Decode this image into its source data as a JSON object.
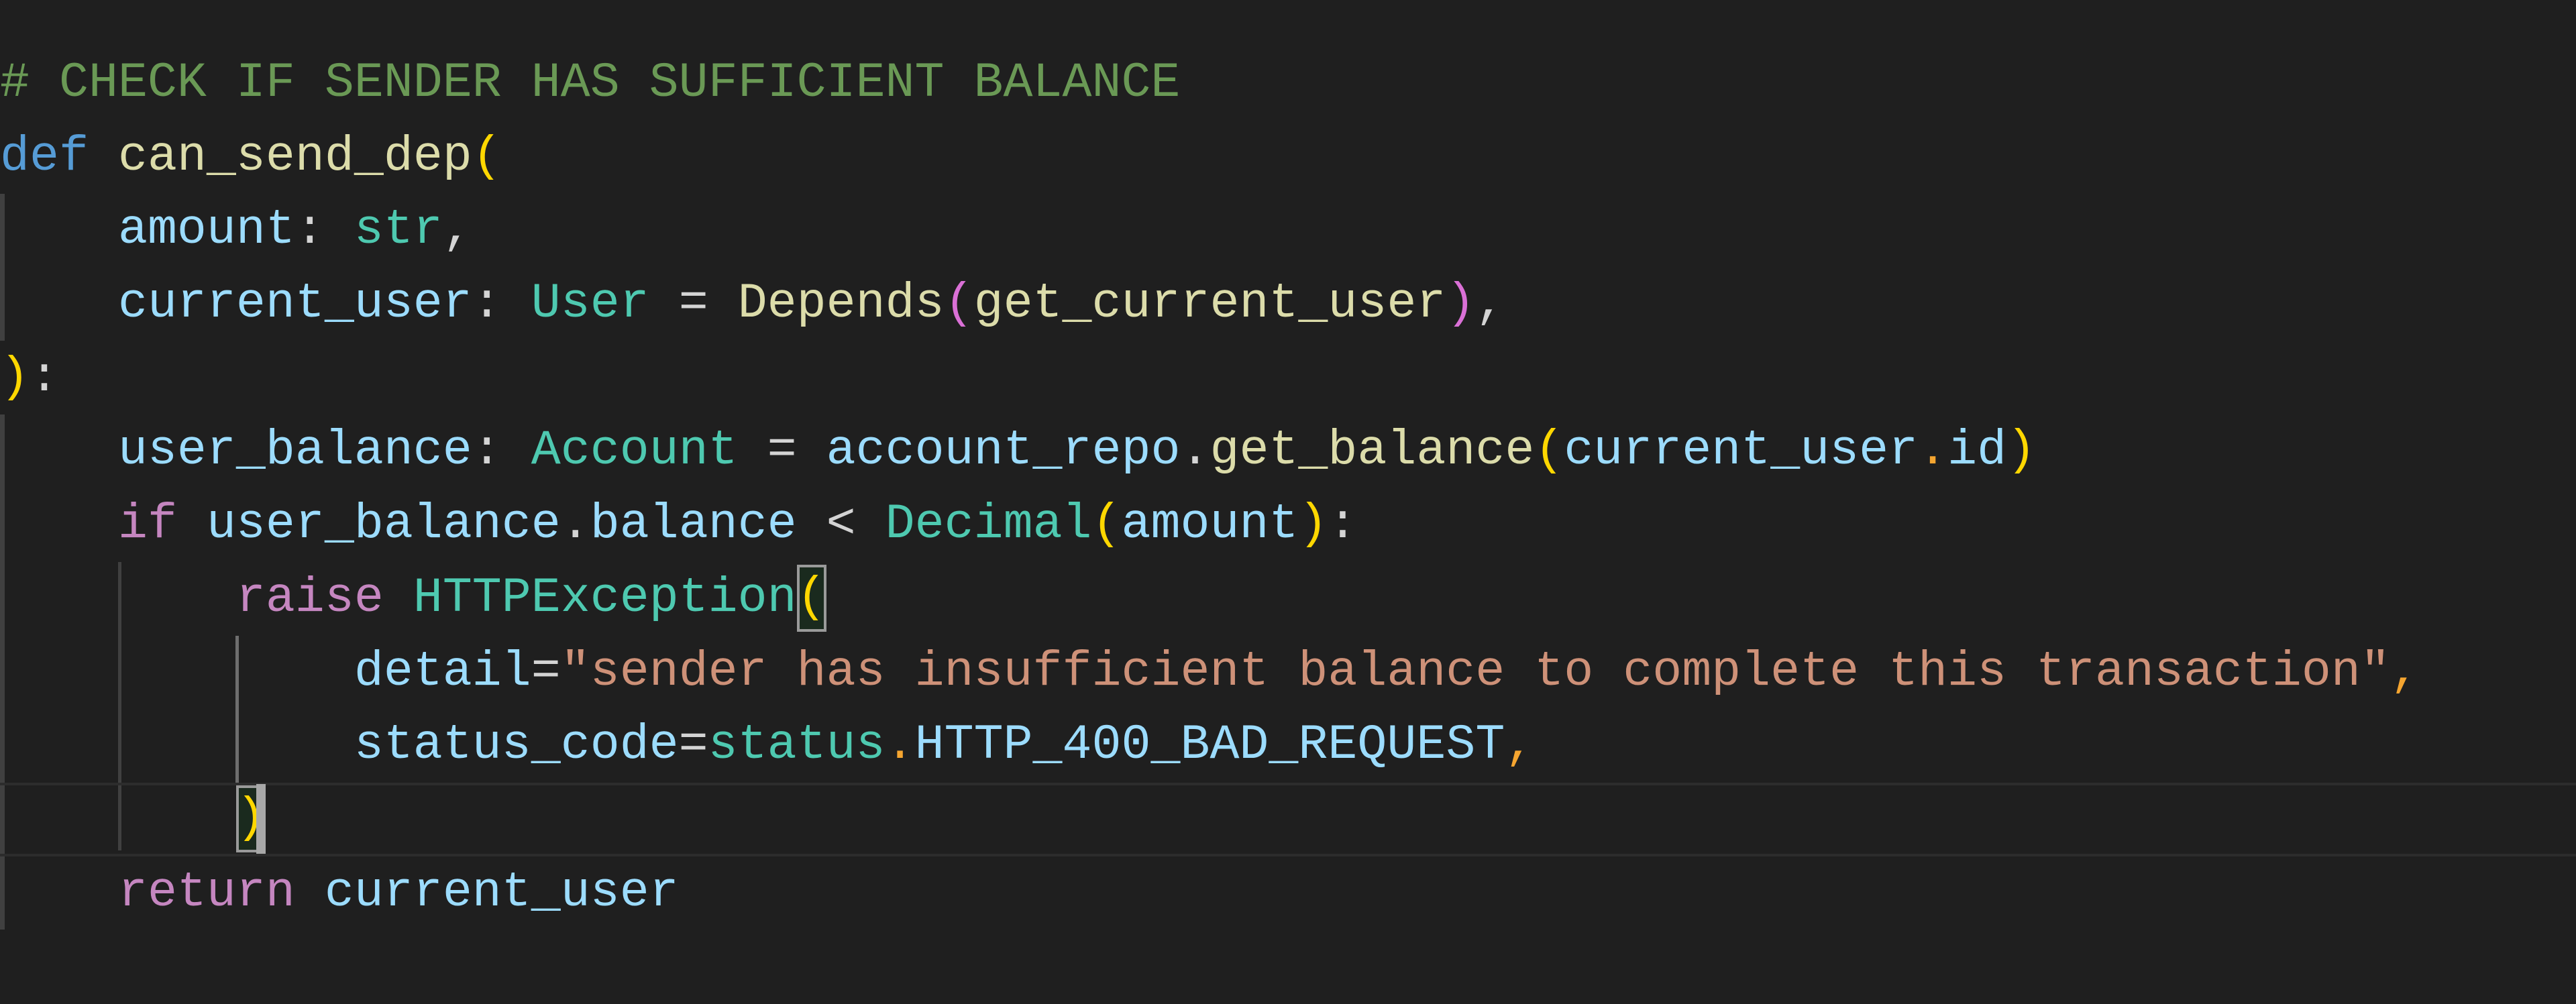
{
  "editor": {
    "language": "python",
    "theme_colors": {
      "background": "#1f1f1f",
      "comment": "#6a9955",
      "keyword": "#569cd6",
      "function": "#dcdcaa",
      "variable": "#9cdcfe",
      "type": "#4ec9b0",
      "control": "#c586c0",
      "string": "#ce9178",
      "bracket_level1": "#ffd700",
      "bracket_level2": "#da70d6",
      "accent_punctuation": "#f5a530"
    },
    "cursor_line": 11,
    "lines": [
      [
        {
          "t": "# CHECK IF SENDER HAS SUFFICIENT BALANCE",
          "k": "comment"
        }
      ],
      [
        {
          "t": "def",
          "k": "def"
        },
        {
          "t": " ",
          "k": "punct"
        },
        {
          "t": "can_send_dep",
          "k": "fn"
        },
        {
          "t": "(",
          "k": "b1"
        }
      ],
      [
        {
          "t": "    ",
          "k": "punct"
        },
        {
          "t": "amount",
          "k": "var"
        },
        {
          "t": ": ",
          "k": "punct"
        },
        {
          "t": "str",
          "k": "type"
        },
        {
          "t": ",",
          "k": "punct"
        }
      ],
      [
        {
          "t": "    ",
          "k": "punct"
        },
        {
          "t": "current_user",
          "k": "var"
        },
        {
          "t": ": ",
          "k": "punct"
        },
        {
          "t": "User",
          "k": "type"
        },
        {
          "t": " = ",
          "k": "punct"
        },
        {
          "t": "Depends",
          "k": "fn"
        },
        {
          "t": "(",
          "k": "b2"
        },
        {
          "t": "get_current_user",
          "k": "fn"
        },
        {
          "t": ")",
          "k": "b2"
        },
        {
          "t": ",",
          "k": "punct"
        }
      ],
      [
        {
          "t": ")",
          "k": "b1"
        },
        {
          "t": ":",
          "k": "punct"
        }
      ],
      [
        {
          "t": "    ",
          "k": "punct"
        },
        {
          "t": "user_balance",
          "k": "var"
        },
        {
          "t": ": ",
          "k": "punct"
        },
        {
          "t": "Account",
          "k": "type"
        },
        {
          "t": " = ",
          "k": "punct"
        },
        {
          "t": "account_repo",
          "k": "var"
        },
        {
          "t": ".",
          "k": "punct"
        },
        {
          "t": "get_balance",
          "k": "fn"
        },
        {
          "t": "(",
          "k": "b1"
        },
        {
          "t": "current_user",
          "k": "var"
        },
        {
          "t": ".",
          "k": "orange"
        },
        {
          "t": "id",
          "k": "var"
        },
        {
          "t": ")",
          "k": "b1"
        }
      ],
      [
        {
          "t": "    ",
          "k": "punct"
        },
        {
          "t": "if",
          "k": "ctrl"
        },
        {
          "t": " ",
          "k": "punct"
        },
        {
          "t": "user_balance",
          "k": "var"
        },
        {
          "t": ".",
          "k": "punct"
        },
        {
          "t": "balance",
          "k": "var"
        },
        {
          "t": " < ",
          "k": "punct"
        },
        {
          "t": "Decimal",
          "k": "type"
        },
        {
          "t": "(",
          "k": "b1"
        },
        {
          "t": "amount",
          "k": "var"
        },
        {
          "t": ")",
          "k": "b1"
        },
        {
          "t": ":",
          "k": "punct"
        }
      ],
      [
        {
          "t": "        ",
          "k": "punct"
        },
        {
          "t": "raise",
          "k": "ctrl"
        },
        {
          "t": " ",
          "k": "punct"
        },
        {
          "t": "HTTPException",
          "k": "type"
        },
        {
          "t": "(",
          "k": "b1",
          "match": true
        }
      ],
      [
        {
          "t": "            ",
          "k": "punct"
        },
        {
          "t": "detail",
          "k": "var"
        },
        {
          "t": "=",
          "k": "punct"
        },
        {
          "t": "\"sender has insufficient balance to complete this transaction\"",
          "k": "str"
        },
        {
          "t": ",",
          "k": "orange"
        }
      ],
      [
        {
          "t": "            ",
          "k": "punct"
        },
        {
          "t": "status_code",
          "k": "var"
        },
        {
          "t": "=",
          "k": "punct"
        },
        {
          "t": "status",
          "k": "type"
        },
        {
          "t": ".",
          "k": "orange"
        },
        {
          "t": "HTTP_400_BAD_REQUEST",
          "k": "var"
        },
        {
          "t": ",",
          "k": "orange"
        }
      ],
      [
        {
          "t": "        ",
          "k": "punct"
        },
        {
          "t": ")",
          "k": "b1",
          "match": true,
          "cursor_after": true
        }
      ],
      [
        {
          "t": "    ",
          "k": "punct"
        },
        {
          "t": "return",
          "k": "ctrl"
        },
        {
          "t": " ",
          "k": "punct"
        },
        {
          "t": "current_user",
          "k": "var"
        }
      ]
    ]
  }
}
